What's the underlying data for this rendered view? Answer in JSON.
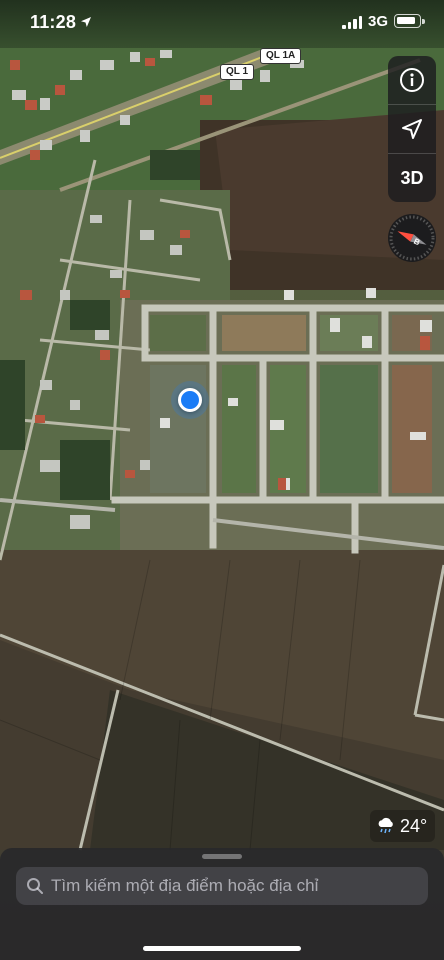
{
  "status_bar": {
    "time": "11:28",
    "network": "3G",
    "icons": [
      "location-arrow-icon",
      "cellular-signal-icon",
      "battery-icon"
    ]
  },
  "map": {
    "type": "satellite",
    "road_shields": [
      "QL 1A",
      "QL 1"
    ],
    "controls": {
      "info_icon": "info-icon",
      "tracking_icon": "location-arrow-icon",
      "three_d_label": "3D",
      "compass_icon": "compass-icon"
    }
  },
  "weather": {
    "icon": "rain-cloud-icon",
    "temperature": "24°"
  },
  "search": {
    "placeholder": "Tìm kiếm một địa điểm hoặc địa chỉ",
    "icon": "search-icon"
  },
  "colors": {
    "user_location": "#1a7cf6",
    "compass_needle": "#ff4f3f"
  }
}
